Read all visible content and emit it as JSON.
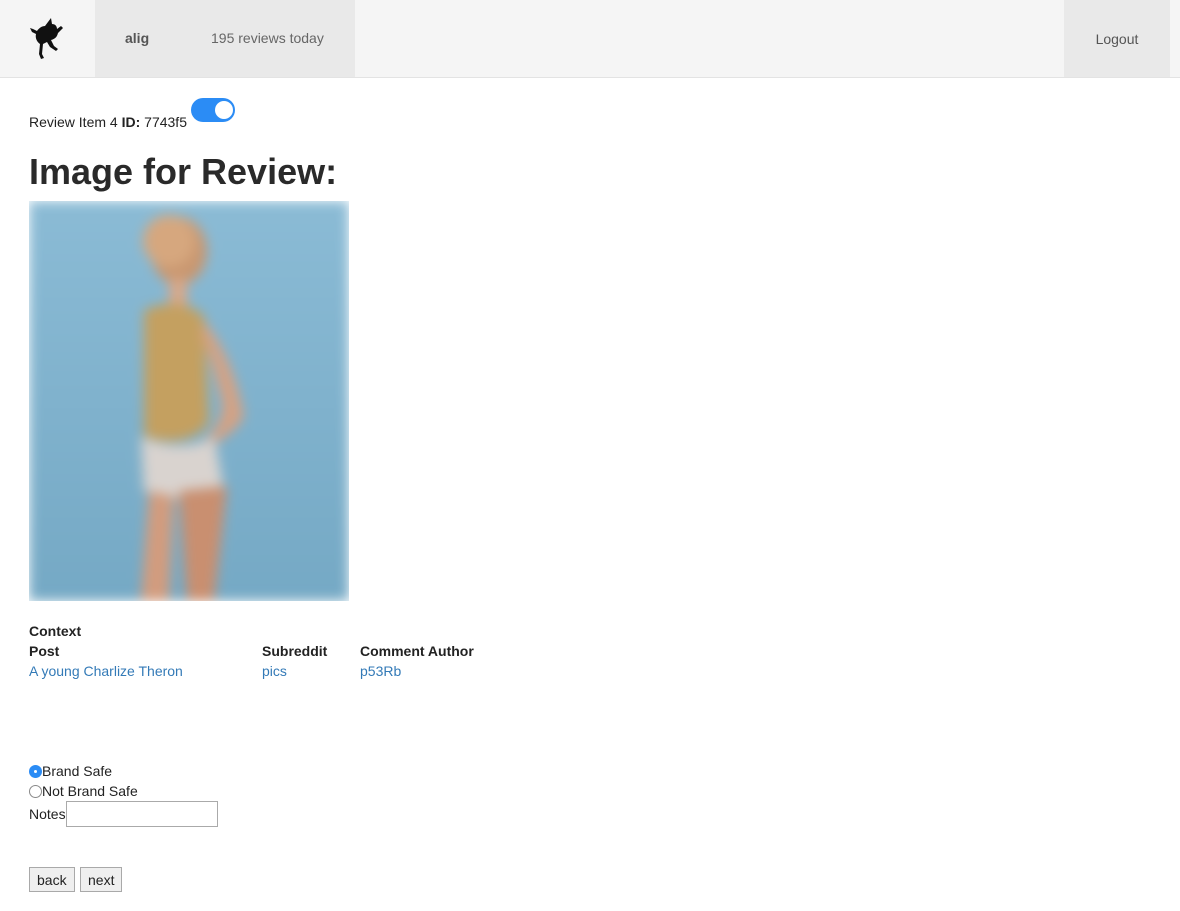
{
  "navbar": {
    "logo_icon": "cat-logo-icon",
    "username": "alig",
    "reviews_today": "195 reviews today",
    "logout_label": "Logout"
  },
  "review": {
    "item_label": "Review Item 4",
    "id_label": "ID:",
    "id_value": "7743f5",
    "toggle_on": true,
    "heading": "Image for Review:"
  },
  "context": {
    "label": "Context",
    "headers": {
      "post": "Post",
      "subreddit": "Subreddit",
      "author": "Comment Author"
    },
    "values": {
      "post": "A young Charlize Theron",
      "subreddit": "pics",
      "author": "p53Rb"
    }
  },
  "form": {
    "options": [
      {
        "label": "Brand Safe",
        "checked": true
      },
      {
        "label": "Not Brand Safe",
        "checked": false
      }
    ],
    "notes_label": "Notes",
    "notes_value": "",
    "back_label": "back",
    "next_label": "next"
  },
  "colors": {
    "accent": "#2b8cf5",
    "link": "#337ab7",
    "navbar_bg": "#f5f5f5"
  }
}
